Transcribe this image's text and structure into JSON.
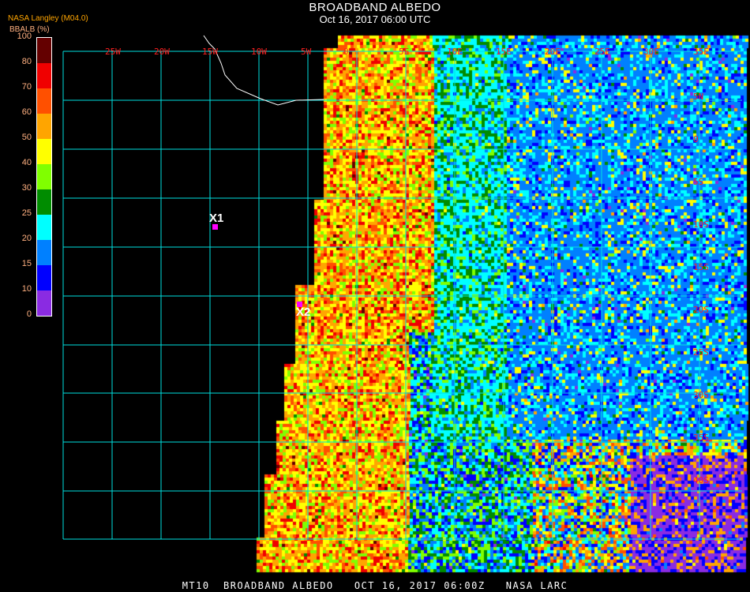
{
  "header": {
    "title": "BROADBAND ALBEDO",
    "datetime": "Oct 16, 2017 06:00 UTC"
  },
  "legend": {
    "source": "NASA Langley (M04.0)",
    "unit": "BBALB (%)",
    "ticks": [
      "0",
      "10",
      "15",
      "20",
      "25",
      "30",
      "40",
      "50",
      "60",
      "70",
      "80",
      "100"
    ],
    "colors": [
      "#8a2be2",
      "#0000ff",
      "#0080ff",
      "#00ffff",
      "#008c00",
      "#80ff00",
      "#ffff00",
      "#ffa500",
      "#ff5000",
      "#f00000",
      "#640000"
    ]
  },
  "grid": {
    "lon_labels": [
      "25W",
      "20W",
      "15W",
      "10W",
      "5W",
      "0",
      "5E",
      "10E",
      "15E",
      "20E",
      "25E",
      "30E",
      "35E"
    ],
    "lat_labels": [
      "5N",
      "0",
      "5S",
      "10S",
      "15S",
      "20S",
      "25S",
      "30S",
      "35S",
      "40S"
    ],
    "line_color": "#00e0e0"
  },
  "markers": [
    {
      "label": "X1"
    },
    {
      "label": "X2"
    }
  ],
  "footer": "MT10  BROADBAND ALBEDO   OCT 16, 2017 06:00Z   NASA LARC"
}
